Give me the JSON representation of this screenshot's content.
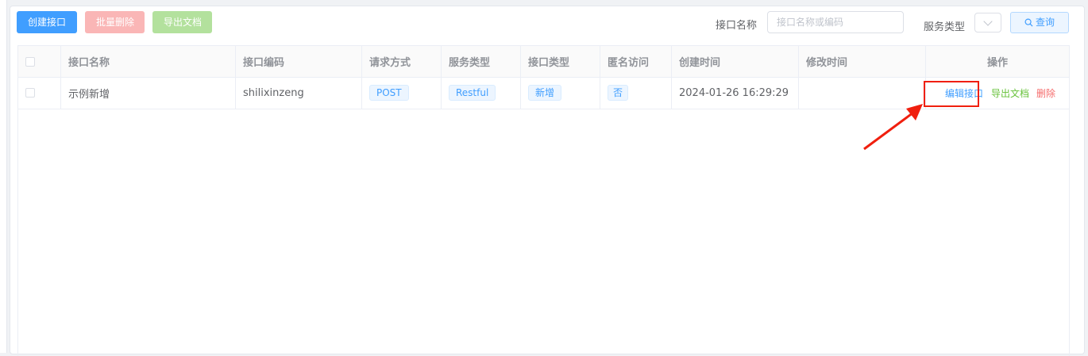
{
  "toolbar": {
    "create_label": "创建接口",
    "batch_delete_label": "批量删除",
    "export_label": "导出文档",
    "filter_name_label": "接口名称",
    "filter_name_placeholder": "接口名称或编码",
    "filter_service_label": "服务类型",
    "query_label": "查询"
  },
  "table": {
    "headers": [
      "接口名称",
      "接口编码",
      "请求方式",
      "服务类型",
      "接口类型",
      "匿名访问",
      "创建时间",
      "修改时间",
      "操作"
    ],
    "rows": [
      {
        "name": "示例新增",
        "code": "shilixinzeng",
        "method": "POST",
        "service_type": "Restful",
        "interface_type": "新增",
        "anonymous": "否",
        "created": "2024-01-26 16:29:29",
        "modified": "",
        "actions": {
          "edit": "编辑接口",
          "export": "导出文档",
          "delete": "删除"
        }
      }
    ]
  },
  "colors": {
    "primary": "#409eff",
    "success": "#67c23a",
    "danger": "#f56c6c",
    "annotation": "#f01f0e"
  },
  "icons": {
    "query": "search-icon",
    "select": "chevron-down-icon"
  }
}
